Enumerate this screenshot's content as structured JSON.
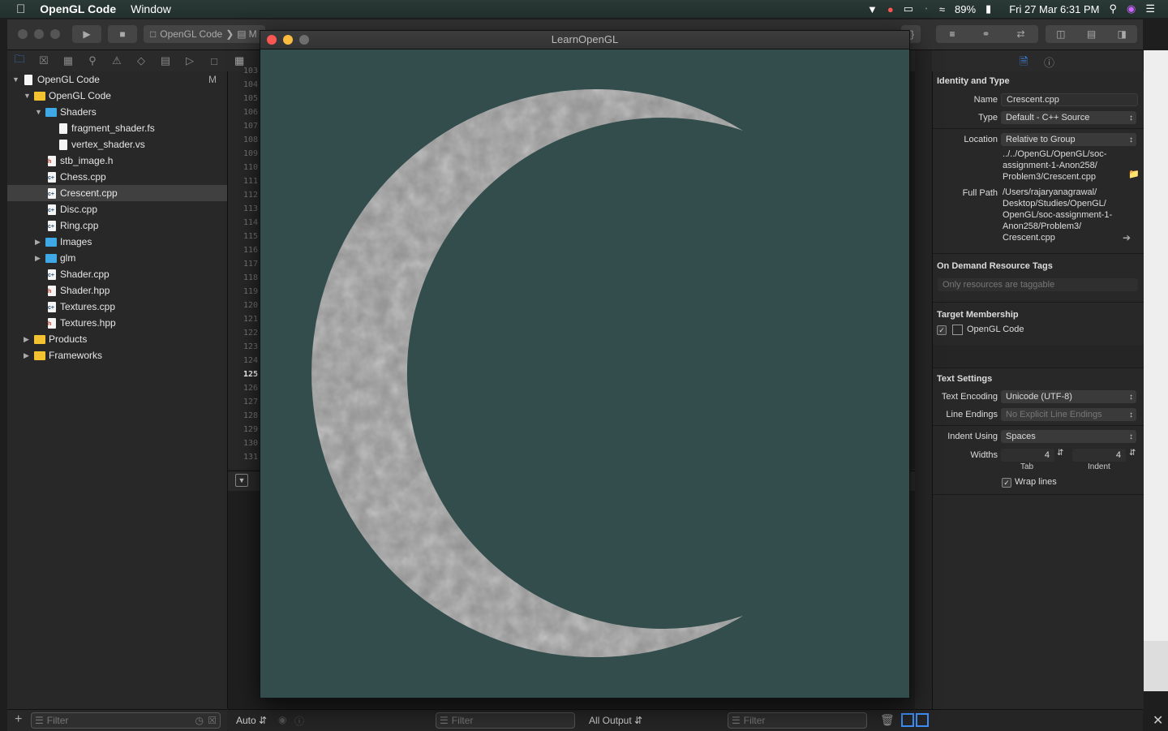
{
  "menubar": {
    "app_name": "OpenGL Code",
    "menu_window": "Window",
    "battery": "89%",
    "datetime": "Fri 27 Mar  6:31 PM"
  },
  "toolbar": {
    "scheme": "OpenGL Code",
    "destination": "M"
  },
  "navigator": {
    "items": [
      {
        "label": "OpenGL Code",
        "badge": "M"
      },
      {
        "label": "OpenGL Code"
      },
      {
        "label": "Shaders"
      },
      {
        "label": "fragment_shader.fs"
      },
      {
        "label": "vertex_shader.vs"
      },
      {
        "label": "stb_image.h"
      },
      {
        "label": "Chess.cpp"
      },
      {
        "label": "Crescent.cpp"
      },
      {
        "label": "Disc.cpp"
      },
      {
        "label": "Ring.cpp"
      },
      {
        "label": "Images"
      },
      {
        "label": "glm"
      },
      {
        "label": "Shader.cpp"
      },
      {
        "label": "Shader.hpp"
      },
      {
        "label": "Textures.cpp"
      },
      {
        "label": "Textures.hpp"
      },
      {
        "label": "Products"
      },
      {
        "label": "Frameworks"
      }
    ],
    "filter_placeholder": "Filter"
  },
  "gutter": {
    "lines": [
      "103",
      "104",
      "105",
      "106",
      "107",
      "108",
      "109",
      "110",
      "111",
      "112",
      "113",
      "114",
      "115",
      "116",
      "117",
      "118",
      "119",
      "120",
      "121",
      "122",
      "123",
      "124",
      "125",
      "126",
      "127",
      "128",
      "129",
      "130",
      "131"
    ],
    "current_line": "125"
  },
  "console": {
    "auto_label": "Auto",
    "filter_left": "Filter",
    "output_label": "All Output",
    "filter_right": "Filter"
  },
  "glwindow": {
    "title": "LearnOpenGL",
    "clear_color": "#334d4d",
    "crescent_color": "#8f8f8f"
  },
  "inspector": {
    "identity_header": "Identity and Type",
    "name_label": "Name",
    "name_value": "Crescent.cpp",
    "type_label": "Type",
    "type_value": "Default - C++ Source",
    "location_label": "Location",
    "location_value": "Relative to Group",
    "relative_path": "../../OpenGL/OpenGL/soc-\nassignment-1-Anon258/\nProblem3/Crescent.cpp",
    "fullpath_label": "Full Path",
    "full_path": "/Users/rajaryanagrawal/\nDesktop/Studies/OpenGL/\nOpenGL/soc-assignment-1-\nAnon258/Problem3/\nCrescent.cpp",
    "odr_header": "On Demand Resource Tags",
    "odr_placeholder": "Only resources are taggable",
    "target_header": "Target Membership",
    "target_name": "OpenGL Code",
    "text_header": "Text Settings",
    "encoding_label": "Text Encoding",
    "encoding_value": "Unicode (UTF-8)",
    "line_endings_label": "Line Endings",
    "line_endings_value": "No Explicit Line Endings",
    "indent_label": "Indent Using",
    "indent_value": "Spaces",
    "widths_label": "Widths",
    "tab_value": "4",
    "indent_width_value": "4",
    "tab_caption": "Tab",
    "indent_caption": "Indent",
    "wrap_label": "Wrap lines"
  }
}
